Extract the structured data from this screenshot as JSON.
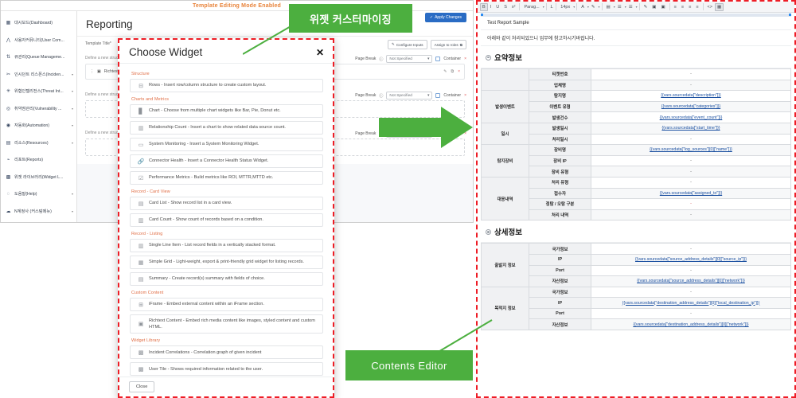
{
  "left": {
    "banner_text": "Template Editing Mode Enabled",
    "page_title": "Reporting",
    "apply_button": "Apply Changes",
    "template_title_label": "Template Title*",
    "configure_inputs": "Configure Inputs",
    "assign_roles": "Assign to roles",
    "struct_label": "Define a new structure",
    "page_break_label": "Page Break",
    "not_specified": "Not Specified",
    "container_label": "Container",
    "widget_card_label": "Richtext Content",
    "sidebar": {
      "items": [
        {
          "label": "대시보드(Dashboard)",
          "icon": "dashboard-icon",
          "caret": false
        },
        {
          "label": "사용자커뮤니티(User Com...",
          "icon": "community-icon",
          "caret": false
        },
        {
          "label": "큐관리(Queue Manageme...",
          "icon": "queue-icon",
          "caret": false
        },
        {
          "label": "인시던트 리스폰스(Inciden...",
          "icon": "incident-icon",
          "caret": true
        },
        {
          "label": "위협인텔리전스(Threat Int...",
          "icon": "threat-icon",
          "caret": true
        },
        {
          "label": "취약점관리(Vulnerability ...",
          "icon": "vuln-icon",
          "caret": true
        },
        {
          "label": "자동화(Automation)",
          "icon": "automation-icon",
          "caret": true
        },
        {
          "label": "리소스(Resources)",
          "icon": "resources-icon",
          "caret": true
        },
        {
          "label": "리포트(Reports)",
          "icon": "reports-icon",
          "caret": false
        },
        {
          "label": "위젯 라이브러리(Widget L...",
          "icon": "widget-library-icon",
          "caret": false
        },
        {
          "label": "도움말(Help)",
          "icon": "help-icon",
          "caret": true
        },
        {
          "label": "N계정사 (커스텀메뉴)",
          "icon": "account-icon",
          "caret": true
        }
      ]
    }
  },
  "modal": {
    "title": "Choose Widget",
    "close_icon": "✕",
    "close_button": "Close",
    "groups": [
      {
        "title": "Structure",
        "options": [
          {
            "icon": "rows-icon",
            "text": "Rows - Insert row/column structure to create custom layout."
          }
        ]
      },
      {
        "title": "Charts and Metrics",
        "options": [
          {
            "icon": "bar-chart-icon",
            "text": "Chart - Choose from multiple chart widgets like Bar, Pie, Donut etc."
          },
          {
            "icon": "relationship-icon",
            "text": "Relationship Count - Insert a chart to show related data source count."
          },
          {
            "icon": "monitor-icon",
            "text": "System Monitoring - Insert a System Monitoring Widget."
          },
          {
            "icon": "link-icon",
            "text": "Connector Health - Insert a Connector Health Status Widget."
          },
          {
            "icon": "metrics-icon",
            "text": "Performance Metrics - Build metrics like ROI, MTTR,MTTD etc."
          }
        ]
      },
      {
        "title": "Record - Card View",
        "options": [
          {
            "icon": "card-list-icon",
            "text": "Card List - Show record list in a card view."
          },
          {
            "icon": "card-count-icon",
            "text": "Card Count - Show count of records based on a condition."
          }
        ]
      },
      {
        "title": "Record - Listing",
        "options": [
          {
            "icon": "single-line-icon",
            "text": "Single Line Item - List record fields in a vertically stacked format."
          },
          {
            "icon": "grid-icon",
            "text": "Simple Grid - Light-weight, export & print-friendly grid widget for listing records."
          },
          {
            "icon": "summary-icon",
            "text": "Summary - Create record(s) summary with fields of choice."
          }
        ]
      },
      {
        "title": "Custom Content",
        "options": [
          {
            "icon": "iframe-icon",
            "text": "iFrame - Embed external content within an iFrame section."
          },
          {
            "icon": "richtext-icon",
            "text": "Richtext Content - Embed rich media content like images, styled content and custom HTML."
          }
        ]
      },
      {
        "title": "Widget Library",
        "options": [
          {
            "icon": "correlation-icon",
            "text": "Incident Correlations - Correlation graph of given incident"
          },
          {
            "icon": "user-tile-icon",
            "text": "User Tile - Shows required information related to the user."
          }
        ]
      }
    ]
  },
  "callouts": {
    "widget_customizing": "위젯 커스터마이징",
    "contents_editor": "Contents Editor",
    "color": "#4caf3f"
  },
  "right": {
    "toolbar": {
      "paragraph": "Parag...",
      "font_size": "14px",
      "items": [
        "bold-icon",
        "italic-icon",
        "underline-icon",
        "strikethrough-icon",
        "superscript-icon",
        "paragraph-select",
        "clear-format-icon",
        "font-size-select",
        "text-color-icon",
        "highlight-color-icon",
        "table-icon",
        "list-bullet-icon",
        "list-number-icon",
        "pencil-icon",
        "image-icon",
        "media-icon",
        "align-left-icon",
        "align-center-icon",
        "align-right-icon",
        "align-justify-icon",
        "code-icon",
        "source-icon"
      ]
    },
    "doc": {
      "line1": "Test Report Sample",
      "line2": "아래와 같이 처리되었으니 업무에 참고하시기바랍니다.",
      "sections": [
        {
          "title": "요약정보",
          "rows": [
            {
              "group": "",
              "key": "티켓번호",
              "value": "-",
              "is_var": false
            },
            {
              "group": "",
              "key": "업체명",
              "value": "-",
              "is_var": false
            },
            {
              "group": "발생이벤트",
              "key": "탐지명",
              "value": "{{vars.sourcedata[\"description\"]}}",
              "is_var": true
            },
            {
              "group": "",
              "key": "이벤트 유형",
              "value": "{{vars.sourcedata[\"categories\"]}}",
              "is_var": true
            },
            {
              "group": "",
              "key": "발생건수",
              "value": "{{vars.sourcedata[\"event_count\"]}}",
              "is_var": true
            },
            {
              "group": "일시",
              "key": "발생일시",
              "value": "{{vars.sourcedata[\"start_time\"]}}",
              "is_var": true
            },
            {
              "group": "",
              "key": "처리일시",
              "value": "-",
              "is_var": false
            },
            {
              "group": "탐지장비",
              "key": "장비명",
              "value": "{{vars.sourcedata[\"log_sources\"][0][\"name\"]}}",
              "is_var": true
            },
            {
              "group": "",
              "key": "장비 IP",
              "value": "-",
              "is_var": false
            },
            {
              "group": "",
              "key": "장비 유형",
              "value": "-",
              "is_var": false
            },
            {
              "group": "대응내역",
              "key": "처리 유형",
              "value": "-",
              "is_var": false
            },
            {
              "group": "",
              "key": "접수자",
              "value": "{{vars.sourcedata[\"assigned_to\"]}}",
              "is_var": true
            },
            {
              "group": "",
              "key": "정탐 / 오탐 구분",
              "value": "-",
              "is_var": false,
              "red": true
            },
            {
              "group": "",
              "key": "처리 내역",
              "value": "-",
              "is_var": false
            }
          ]
        },
        {
          "title": "상세정보",
          "rows": [
            {
              "group": "출발지 정보",
              "key": "국가정보",
              "value": "-",
              "is_var": false
            },
            {
              "group": "",
              "key": "IP",
              "value": "{{vars.sourcedata[\"source_address_details\"][0][\"source_ip\"]}}",
              "is_var": true
            },
            {
              "group": "",
              "key": "Port",
              "value": "-",
              "is_var": false
            },
            {
              "group": "",
              "key": "자산정보",
              "value": "{{vars.sourcedata[\"source_address_details\"][0][\"network\"]}}",
              "is_var": true
            },
            {
              "group": "목적지 정보",
              "key": "국가정보",
              "value": "-",
              "is_var": false
            },
            {
              "group": "",
              "key": "IP",
              "value": "{{vars.sourcedata[\"destination_address_details\"][0][\"local_destination_ip\"]}}",
              "is_var": true
            },
            {
              "group": "",
              "key": "Port",
              "value": "-",
              "is_var": false
            },
            {
              "group": "",
              "key": "자산정보",
              "value": "{{vars.sourcedata[\"destination_address_details\"][0][\"network\"]}}",
              "is_var": true
            }
          ]
        }
      ]
    }
  }
}
